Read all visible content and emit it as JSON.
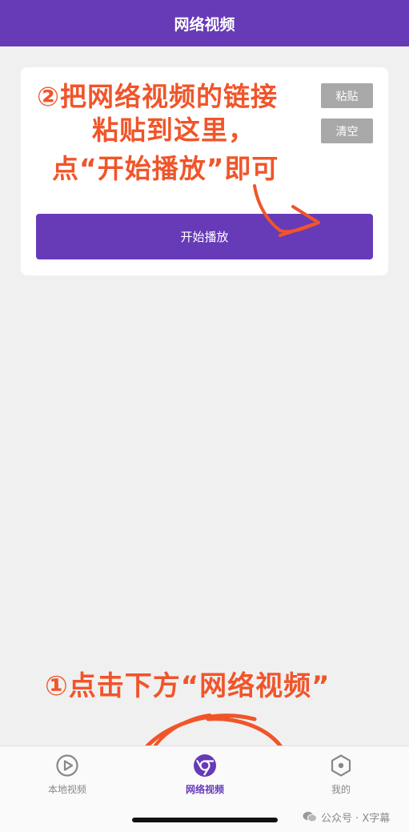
{
  "colors": {
    "primary": "#673ab7",
    "grey_button": "#a8a8a8",
    "annotation": "#f0552a",
    "tab_inactive": "#888888"
  },
  "app_bar": {
    "title": "网络视频"
  },
  "url_input": {
    "value": "",
    "placeholder": ""
  },
  "buttons": {
    "paste": "粘贴",
    "clear": "清空",
    "play": "开始播放"
  },
  "annotations": {
    "step2_line1": "②把网络视频的链接",
    "step2_line2": "粘贴到这里，",
    "step2_line3": "点“开始播放”即可",
    "step1": "①点击下方“网络视频”"
  },
  "tabs": [
    {
      "label": "本地视频",
      "icon": "play-circle-icon",
      "active": false
    },
    {
      "label": "网络视频",
      "icon": "chrome-icon",
      "active": true
    },
    {
      "label": "我的",
      "icon": "hexagon-settings-icon",
      "active": false
    }
  ],
  "watermark": {
    "icon": "wechat-icon",
    "text": "公众号 · X字幕"
  }
}
